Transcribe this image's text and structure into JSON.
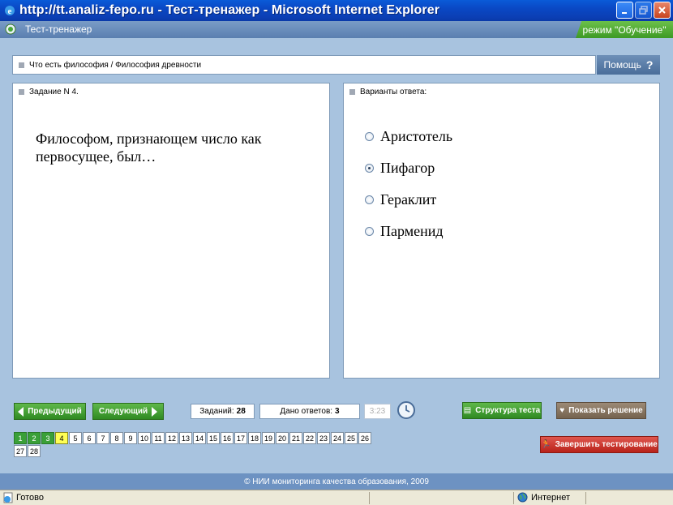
{
  "window": {
    "title": "http://tt.analiz-fepo.ru - Тест-тренажер - Microsoft Internet Explorer"
  },
  "app": {
    "title": "Тест-тренажер",
    "mode": "режим \"Обучение\""
  },
  "breadcrumb": "Что есть философия / Философия древности",
  "help_label": "Помощь",
  "task": {
    "header": "Задание N 4.",
    "question": "Философом, признающем число как первосущее, был…"
  },
  "answers": {
    "header": "Варианты ответа:",
    "options": [
      {
        "label": "Аристотель",
        "selected": false
      },
      {
        "label": "Пифагор",
        "selected": true
      },
      {
        "label": "Гераклит",
        "selected": false
      },
      {
        "label": "Парменид",
        "selected": false
      }
    ]
  },
  "toolbar": {
    "prev_label": "Предыдущий",
    "next_label": "Следующий",
    "total_label": "Заданий:",
    "total_value": "28",
    "answered_label": "Дано ответов:",
    "answered_value": "3",
    "timer": "3:23",
    "structure_label": "Структура теста",
    "solution_label": "Показать решение",
    "finish_label": "Завершить тестирование"
  },
  "questions": {
    "items": [
      "1",
      "2",
      "3",
      "4",
      "5",
      "6",
      "7",
      "8",
      "9",
      "10",
      "11",
      "12",
      "13",
      "14",
      "15",
      "16",
      "17",
      "18",
      "19",
      "20",
      "21",
      "22",
      "23",
      "24",
      "25",
      "26",
      "27",
      "28"
    ],
    "done": [
      1,
      2,
      3
    ],
    "current": 4
  },
  "footer": "© НИИ мониторинга качества образования, 2009",
  "status": {
    "text": "Готово",
    "zone": "Интернет"
  },
  "colors": {
    "accent_green": "#3aa038",
    "current_yellow": "#ffff55",
    "finish_red": "#c8322a",
    "header_blue": "#6d92c2"
  }
}
